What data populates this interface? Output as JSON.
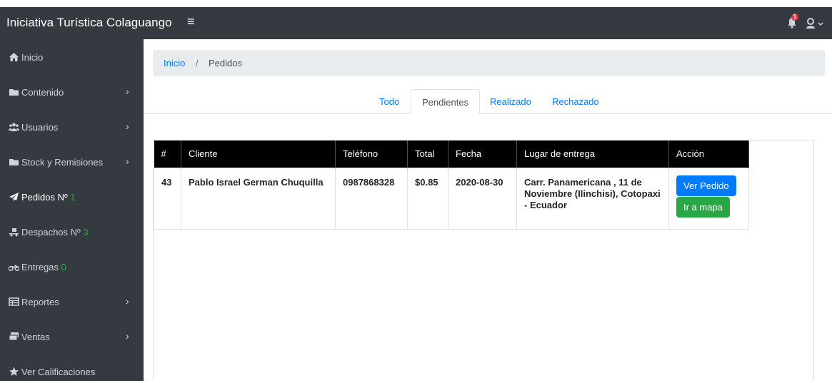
{
  "app": {
    "title": "Iniciativa Turística Colaguango",
    "notification_count": "1"
  },
  "sidebar": {
    "items": [
      {
        "label": "Inicio",
        "count": "",
        "has_chevron": false
      },
      {
        "label": "Contenido",
        "count": "",
        "has_chevron": true
      },
      {
        "label": "Usuarios",
        "count": "",
        "has_chevron": true
      },
      {
        "label": "Stock y Remisiones",
        "count": "",
        "has_chevron": true
      },
      {
        "label": "Pedidos Nº ",
        "count": "1",
        "has_chevron": false
      },
      {
        "label": "Despachos Nº ",
        "count": "3",
        "has_chevron": false
      },
      {
        "label": "Entregas ",
        "count": "0",
        "has_chevron": false
      },
      {
        "label": "Reportes",
        "count": "",
        "has_chevron": true
      },
      {
        "label": "Ventas",
        "count": "",
        "has_chevron": true
      },
      {
        "label": "Ver Calificaciones",
        "count": "",
        "has_chevron": false
      }
    ]
  },
  "breadcrumb": {
    "home": "Inicio",
    "separator": "/",
    "current": "Pedidos"
  },
  "tabs": [
    {
      "label": "Todo",
      "active": false
    },
    {
      "label": "Pendientes",
      "active": true
    },
    {
      "label": "Realizado",
      "active": false
    },
    {
      "label": "Rechazado",
      "active": false
    }
  ],
  "table": {
    "headers": [
      "#",
      "Cliente",
      "Teléfono",
      "Total",
      "Fecha",
      "Lugar de entrega",
      "Acción"
    ],
    "rows": [
      {
        "id": "43",
        "cliente": "Pablo Israel German Chuquilla",
        "telefono": "0987868328",
        "total": "$0.85",
        "fecha": "2020-08-30",
        "lugar": "Carr. Panamericana , 11 de Noviembre (Ilinchisi), Cotopaxi - Ecuador",
        "actions": {
          "ver": "Ver Pedido",
          "mapa": "Ir a mapa"
        }
      }
    ]
  },
  "colors": {
    "sidebar_bg": "#343a40",
    "link": "#007bff",
    "success": "#28a745",
    "danger": "#dc3545"
  }
}
